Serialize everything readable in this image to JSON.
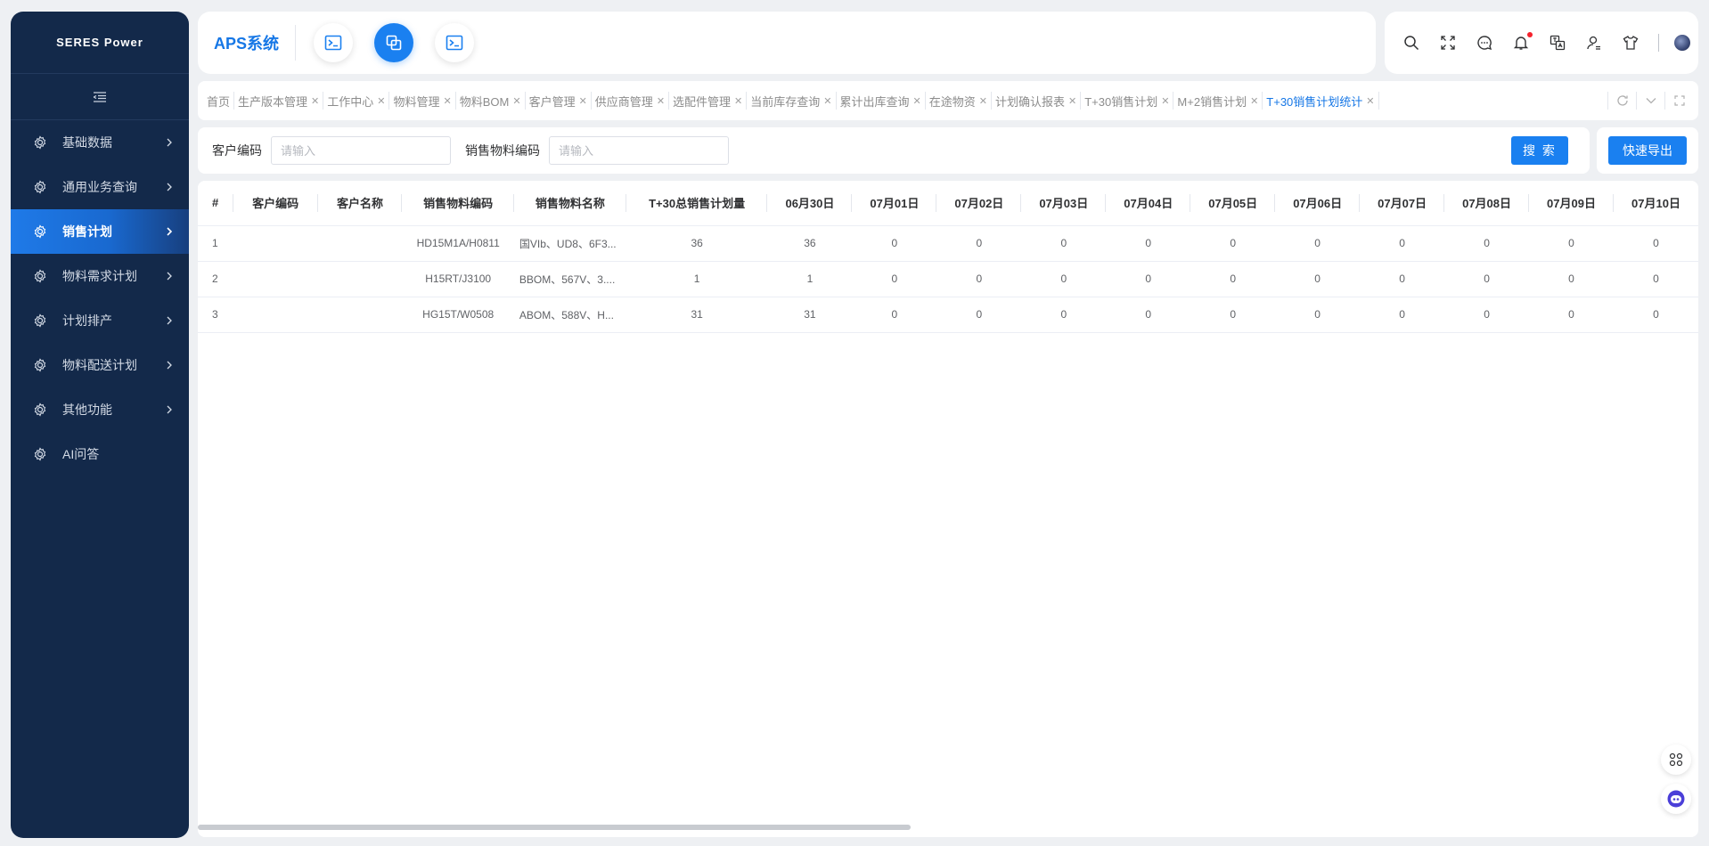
{
  "sidebar": {
    "logo": "SERES Power",
    "items": [
      {
        "label": "基础数据",
        "has_arrow": true
      },
      {
        "label": "通用业务查询",
        "has_arrow": true
      },
      {
        "label": "销售计划",
        "has_arrow": true,
        "active": true
      },
      {
        "label": "物料需求计划",
        "has_arrow": true
      },
      {
        "label": "计划排产",
        "has_arrow": true
      },
      {
        "label": "物料配送计划",
        "has_arrow": true
      },
      {
        "label": "其他功能",
        "has_arrow": true
      },
      {
        "label": "AI问答",
        "has_arrow": false
      }
    ]
  },
  "header": {
    "title": "APS系统"
  },
  "tabs": [
    {
      "label": "首页",
      "closable": false
    },
    {
      "label": "生产版本管理",
      "closable": true
    },
    {
      "label": "工作中心",
      "closable": true
    },
    {
      "label": "物料管理",
      "closable": true
    },
    {
      "label": "物料BOM",
      "closable": true
    },
    {
      "label": "客户管理",
      "closable": true
    },
    {
      "label": "供应商管理",
      "closable": true
    },
    {
      "label": "选配件管理",
      "closable": true
    },
    {
      "label": "当前库存查询",
      "closable": true
    },
    {
      "label": "累计出库查询",
      "closable": true
    },
    {
      "label": "在途物资",
      "closable": true
    },
    {
      "label": "计划确认报表",
      "closable": true
    },
    {
      "label": "T+30销售计划",
      "closable": true
    },
    {
      "label": "M+2销售计划",
      "closable": true
    },
    {
      "label": "T+30销售计划统计",
      "closable": true,
      "active": true
    }
  ],
  "search": {
    "customer_code_label": "客户编码",
    "customer_code_placeholder": "请输入",
    "material_code_label": "销售物料编码",
    "material_code_placeholder": "请输入",
    "search_button": "搜 索",
    "export_button": "快速导出"
  },
  "table": {
    "columns": [
      "#",
      "客户编码",
      "客户名称",
      "销售物料编码",
      "销售物料名称",
      "T+30总销售计划量",
      "06月30日",
      "07月01日",
      "07月02日",
      "07月03日",
      "07月04日",
      "07月05日",
      "07月06日",
      "07月07日",
      "07月08日",
      "07月09日",
      "07月10日"
    ],
    "rows": [
      [
        "1",
        "",
        "",
        "HD15M1A/H0811",
        "国VIb、UD8、6F3...",
        "36",
        "36",
        "0",
        "0",
        "0",
        "0",
        "0",
        "0",
        "0",
        "0",
        "0",
        "0"
      ],
      [
        "2",
        "",
        "",
        "H15RT/J3100",
        "BBOM、567V、3....",
        "1",
        "1",
        "0",
        "0",
        "0",
        "0",
        "0",
        "0",
        "0",
        "0",
        "0",
        "0"
      ],
      [
        "3",
        "",
        "",
        "HG15T/W0508",
        "ABOM、588V、H...",
        "31",
        "31",
        "0",
        "0",
        "0",
        "0",
        "0",
        "0",
        "0",
        "0",
        "0",
        "0"
      ]
    ]
  },
  "colors": {
    "sidebar_bg": "#13294a",
    "accent": "#1a80f0",
    "active_tab": "#1677e6",
    "notification_dot": "#f5222d"
  },
  "icons": {
    "toolbar": [
      "search-icon",
      "fullscreen-icon",
      "message-icon",
      "bell-icon",
      "translate-icon",
      "user-settings-icon",
      "theme-shirt-icon"
    ],
    "floating": [
      "apps-grid-icon",
      "ai-assistant-icon"
    ]
  }
}
